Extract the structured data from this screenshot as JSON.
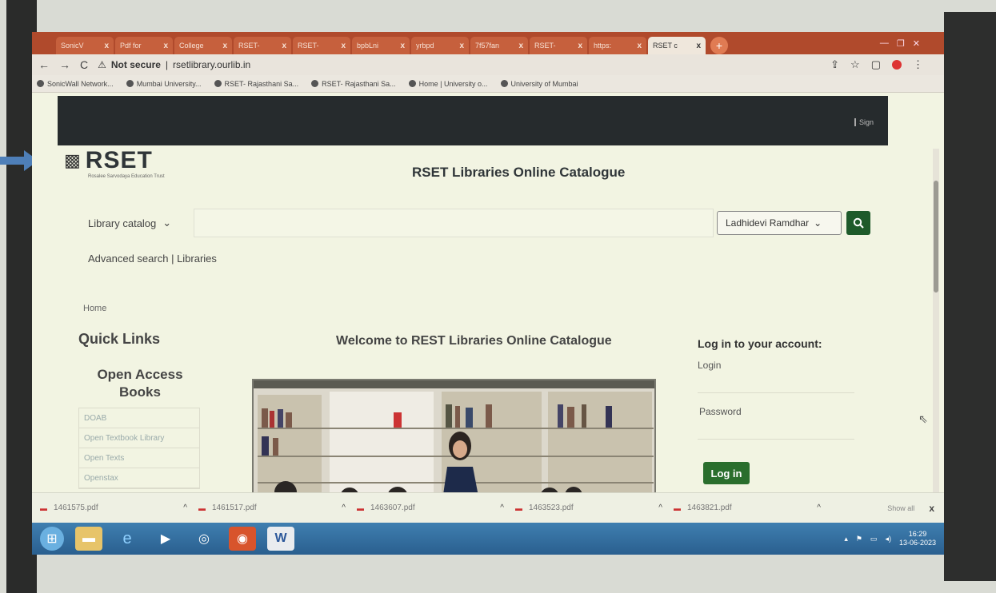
{
  "browser": {
    "tabs": [
      {
        "label": "SonicV",
        "active": false
      },
      {
        "label": "Pdf for",
        "active": false
      },
      {
        "label": "College",
        "active": false
      },
      {
        "label": "RSET-",
        "active": false
      },
      {
        "label": "RSET-",
        "active": false
      },
      {
        "label": "bpbLni",
        "active": false
      },
      {
        "label": "yrbpd",
        "active": false
      },
      {
        "label": "7f57fan",
        "active": false
      },
      {
        "label": "RSET-",
        "active": false
      },
      {
        "label": "https:",
        "active": false
      },
      {
        "label": "RSET c",
        "active": true
      }
    ],
    "tab_close": "x",
    "new_tab": "+",
    "address": {
      "security": "Not secure",
      "url": "rsetlibrary.ourlib.in"
    },
    "bookmarks": [
      "SonicWall Network...",
      "Mumbai University...",
      "RSET- Rajasthani Sa...",
      "RSET- Rajasthani Sa...",
      "Home | University o...",
      "University of Mumbai"
    ]
  },
  "page": {
    "logo_text": "RSET",
    "logo_tagline": "Rosalee Sarvodaya Education Trust",
    "site_title": "RSET Libraries Online Catalogue",
    "search": {
      "category": "Library catalog",
      "library": "Ladhidevi Ramdhar"
    },
    "links": {
      "advanced": "Advanced search",
      "separator": " | ",
      "libraries": "Libraries"
    },
    "breadcrumb": "Home",
    "quick_links_title": "Quick Links",
    "open_access_title": "Open Access Books",
    "open_access_items": [
      "DOAB",
      "Open Textbook Library",
      "Open Texts",
      "Openstax"
    ],
    "welcome": "Welcome to REST Libraries Online Catalogue",
    "login": {
      "title": "Log in to your account:",
      "login_label": "Login",
      "password_label": "Password",
      "button": "Log in"
    }
  },
  "downloads": {
    "files": [
      "1461575.pdf",
      "1461517.pdf",
      "1463607.pdf",
      "1463523.pdf",
      "1463821.pdf"
    ],
    "show_all": "Show all",
    "close": "x"
  },
  "taskbar": {
    "time": "16:29",
    "date": "13-06-2023"
  }
}
